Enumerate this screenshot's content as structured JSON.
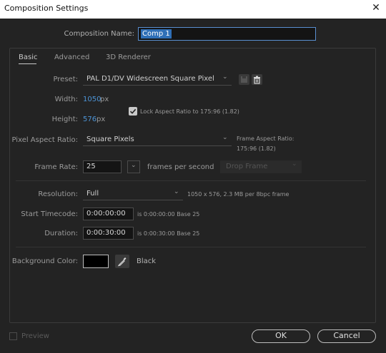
{
  "window": {
    "title": "Composition Settings",
    "close": "✕"
  },
  "comp_name": {
    "label": "Composition Name:",
    "value": "Comp 1"
  },
  "tabs": [
    {
      "label": "Basic",
      "active": true
    },
    {
      "label": "Advanced",
      "active": false
    },
    {
      "label": "3D Renderer",
      "active": false
    }
  ],
  "preset": {
    "label": "Preset:",
    "value": "PAL D1/DV Widescreen Square Pixel",
    "chevron": "⌄",
    "save_icon": "save-preset-icon",
    "delete_icon": "trash-icon"
  },
  "width": {
    "label": "Width:",
    "value": "1050",
    "unit": "px"
  },
  "height": {
    "label": "Height:",
    "value": "576",
    "unit": "px"
  },
  "lock_aspect": {
    "checked": true,
    "label": "Lock Aspect Ratio to 175:96 (1.82)"
  },
  "pixel_aspect": {
    "label": "Pixel Aspect Ratio:",
    "value": "Square Pixels",
    "frame_label": "Frame Aspect Ratio:",
    "frame_value": "175:96 (1.82)"
  },
  "frame_rate": {
    "label": "Frame Rate:",
    "value": "25",
    "unit": "frames per second",
    "drop_frame": "Drop Frame"
  },
  "resolution": {
    "label": "Resolution:",
    "value": "Full",
    "info": "1050 x 576, 2.3 MB per 8bpc frame"
  },
  "start_timecode": {
    "label": "Start Timecode:",
    "value": "0:00:00:00",
    "info": "is 0:00:00:00  Base 25"
  },
  "duration": {
    "label": "Duration:",
    "value": "0:00:30:00",
    "info": "is 0:00:30:00  Base 25"
  },
  "background": {
    "label": "Background Color:",
    "color": "#000000",
    "name": "Black"
  },
  "footer": {
    "preview": "Preview",
    "ok": "OK",
    "cancel": "Cancel"
  },
  "colors": {
    "accent_blue": "#4d94d6",
    "selection": "#2f6fb7",
    "bg": "#232323"
  }
}
